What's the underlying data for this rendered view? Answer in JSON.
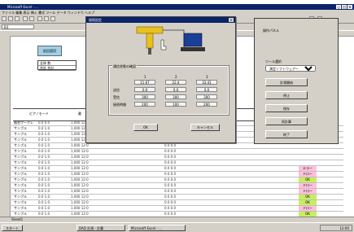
{
  "window": {
    "title": "Microsoft Excel - ...",
    "menu": "ファイル 編集 表示 挿入 書式 ツール データ ウィンドウ ヘルプ"
  },
  "formula_bar": {
    "name_box": "B3"
  },
  "sheet": {
    "button_blue": "前回適用",
    "mini_table": [
      "全体 数",
      "合計 合計"
    ],
    "grid_header": [
      "ピアノモード",
      "最",
      "T",
      "時間"
    ],
    "rows": [
      {
        "c1": "曲名ワークレ",
        "c2": "0.0 0.0",
        "c3": "1,000 12:0",
        "c4": "0.0  0.0",
        "tag": "",
        "tagcolor": ""
      },
      {
        "c1": "サンプル",
        "c2": "0.0 1.0",
        "c3": "1,000 12:0",
        "c4": "0.0  0.0",
        "tag": "",
        "tagcolor": ""
      },
      {
        "c1": "サンプル",
        "c2": "0.0 1.0",
        "c3": "1,000 12:0",
        "c4": "0.0  0.0",
        "tag": "",
        "tagcolor": ""
      },
      {
        "c1": "サンプル",
        "c2": "0.0 1.0",
        "c3": "1,000 12:0",
        "c4": "0.0  0.0",
        "tag": "",
        "tagcolor": ""
      },
      {
        "c1": "サンプル",
        "c2": "0.0 1.0",
        "c3": "1,000 12:0",
        "c4": "0.0  0.0",
        "tag": "",
        "tagcolor": ""
      },
      {
        "c1": "サンプル",
        "c2": "0.0 1.0",
        "c3": "1,000 12:0",
        "c4": "0.0  0.0",
        "tag": "",
        "tagcolor": ""
      },
      {
        "c1": "サンプル",
        "c2": "0.0 1.0",
        "c3": "1,000 12:0",
        "c4": "0.0  0.0",
        "tag": "",
        "tagcolor": ""
      },
      {
        "c1": "サンプル",
        "c2": "0.0 1.0",
        "c3": "1,000 12:0",
        "c4": "0.0  0.0",
        "tag": "",
        "tagcolor": ""
      },
      {
        "c1": "サンプル",
        "c2": "0.0 1.0",
        "c3": "1,000 12:0",
        "c4": "0.0  0.0",
        "tag": "エラー",
        "tagcolor": "pink"
      },
      {
        "c1": "サンプル",
        "c2": "0.0 1.0",
        "c3": "1,000 12:0",
        "c4": "0.0  0.0",
        "tag": "ドロー",
        "tagcolor": "pink"
      },
      {
        "c1": "サンプル",
        "c2": "0.0 1.0",
        "c3": "1,000 12:0",
        "c4": "0.0  0.0",
        "tag": "OK",
        "tagcolor": "lime"
      },
      {
        "c1": "サンプル",
        "c2": "0.0 1.0",
        "c3": "1,000 12:0",
        "c4": "0.0  0.0",
        "tag": "ドロー",
        "tagcolor": "pink"
      },
      {
        "c1": "サンプル",
        "c2": "0.0 1.0",
        "c3": "1,000 12:0",
        "c4": "0.0  0.0",
        "tag": "ドロー",
        "tagcolor": "pink"
      },
      {
        "c1": "サンプル",
        "c2": "0.0 1.0",
        "c3": "1,000 12:0",
        "c4": "0.0  0.0",
        "tag": "OK",
        "tagcolor": "lime"
      },
      {
        "c1": "サンプル",
        "c2": "0.0 1.0",
        "c3": "1,000 12:0",
        "c4": "0.0  0.0",
        "tag": "OK",
        "tagcolor": "lime"
      },
      {
        "c1": "サンプル",
        "c2": "0.0 1.0",
        "c3": "1,000 12:0",
        "c4": "0.0  0.0",
        "tag": "ドロー",
        "tagcolor": "pink"
      },
      {
        "c1": "サンプル",
        "c2": "0.0 1.0",
        "c3": "1,000 12:0",
        "c4": "0.0  0.0",
        "tag": "OK",
        "tagcolor": "lime"
      },
      {
        "c1": "サンプル",
        "c2": "0.0 1.0",
        "c3": "1,000 12:0",
        "c4": "0.0  0.0",
        "tag": "エラー",
        "tagcolor": "pink"
      },
      {
        "c1": "サンプル",
        "c2": "0.0 1.0",
        "c3": "1,000 12:0",
        "c4": "0.0  0.0",
        "tag": "OK",
        "tagcolor": "lime"
      },
      {
        "c1": "サンプル",
        "c2": "0.0 1.0",
        "c3": "1,000 12:0",
        "c4": "0.0  0.0",
        "tag": "",
        "tagcolor": ""
      }
    ]
  },
  "dialog": {
    "title": "接続設定",
    "group_label": "通信状態の確認",
    "col_headers": [
      "1",
      "2",
      "3"
    ],
    "row_labels": [
      "送信",
      "受信",
      "接続時間"
    ],
    "cells": [
      [
        "11.67",
        "22.4",
        "33.41"
      ],
      [
        "0.0",
        "0.0",
        "0.0"
      ],
      [
        "300",
        "300",
        "300"
      ],
      [
        "200",
        "100",
        "200"
      ]
    ],
    "ok": "OK",
    "cancel": "キャンセル"
  },
  "side_panel": {
    "title": "操作パネル",
    "select_label": "ツール選択",
    "select_value": "測定ソフトウェアー",
    "buttons": [
      "計測開始",
      "停止",
      "保存",
      "再計算",
      "終了"
    ]
  },
  "sheet_tab": "Sheet1",
  "taskbar": {
    "start": "スタート",
    "tasks": [
      "DAQ 計測 - 計算",
      "Microsoft Excel - ..."
    ],
    "clock": "12:00"
  },
  "colors": {
    "title_blue": "#0a246a",
    "button_blue": "#9fd0e8",
    "pink": "#ffc0dc",
    "lime": "#c8ee60"
  }
}
